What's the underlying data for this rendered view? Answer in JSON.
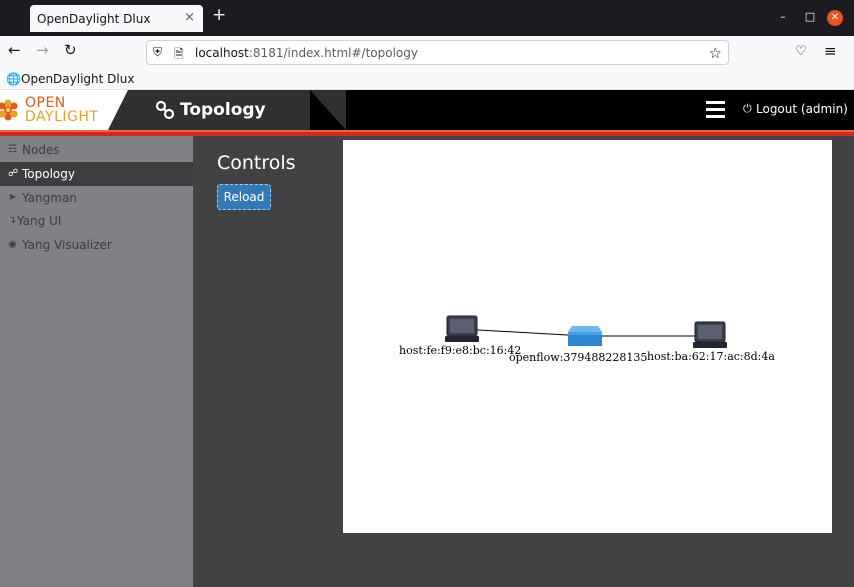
{
  "browser": {
    "tab_title": "OpenDaylight Dlux",
    "tab_close": "×",
    "new_tab": "+",
    "url_host": "localhost",
    "url_rest": ":8181/index.html#/topology",
    "bookmark_label": "OpenDaylight Dlux"
  },
  "app": {
    "logo_top": "OPEN",
    "logo_bottom": "DAYLIGHT",
    "header_title": "Topology",
    "logout_label": "Logout (admin)"
  },
  "sidebar": {
    "items": [
      {
        "label": "Nodes",
        "icon": "sitemap-icon"
      },
      {
        "label": "Topology",
        "icon": "link-icon",
        "active": true
      },
      {
        "label": "Yangman",
        "icon": "rocket-icon"
      },
      {
        "label": "Yang UI",
        "icon": "level-down-icon"
      },
      {
        "label": "Yang Visualizer",
        "icon": "eye-icon"
      }
    ]
  },
  "main": {
    "controls_title": "Controls",
    "reload_label": "Reload"
  },
  "topology": {
    "nodes": [
      {
        "type": "host",
        "label": "host:fe:f9:e8:bc:16:42"
      },
      {
        "type": "switch",
        "label": "openflow:379488228135"
      },
      {
        "type": "host",
        "label": "host:ba:62:17:ac:8d:4a"
      }
    ]
  },
  "colors": {
    "accent_red": "#d12b20",
    "button_blue": "#337ab7",
    "sidebar_bg": "#7f8185",
    "main_bg": "#424244"
  }
}
